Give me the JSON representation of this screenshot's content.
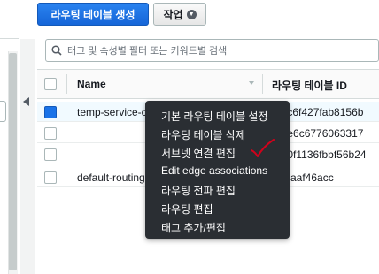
{
  "toolbar": {
    "create_label": "라우팅 테이블 생성",
    "actions_label": "작업"
  },
  "search": {
    "placeholder": "태그 및 속성별 필터 또는 키워드별 검색"
  },
  "table": {
    "columns": [
      "Name",
      "라우팅 테이블 ID"
    ],
    "rows": [
      {
        "name": "temp-service-c",
        "id": "03c6f427fab8156b",
        "selected": true
      },
      {
        "name": "",
        "id": "05e6c6776063317",
        "selected": false
      },
      {
        "name": "",
        "id": "0b0f1136fbbf56b24",
        "selected": false
      },
      {
        "name": "default-routing",
        "id": "aaf46acc",
        "selected": false
      }
    ]
  },
  "context_menu": {
    "items": [
      "기본 라우팅 테이블 설정",
      "라우팅 테이블 삭제",
      "서브넷 연결 편집",
      "Edit edge associations",
      "라우팅 전파 편집",
      "라우팅 편집",
      "태그 추가/편집"
    ]
  },
  "colors": {
    "primary": "#1a73e8",
    "menu_bg": "#2a2e33",
    "check_mark": "#d0021b"
  },
  "icons": [
    "search-icon",
    "collapse-arrow-icon",
    "chevron-down-icon",
    "sort-icon",
    "red-checkmark-icon"
  ]
}
